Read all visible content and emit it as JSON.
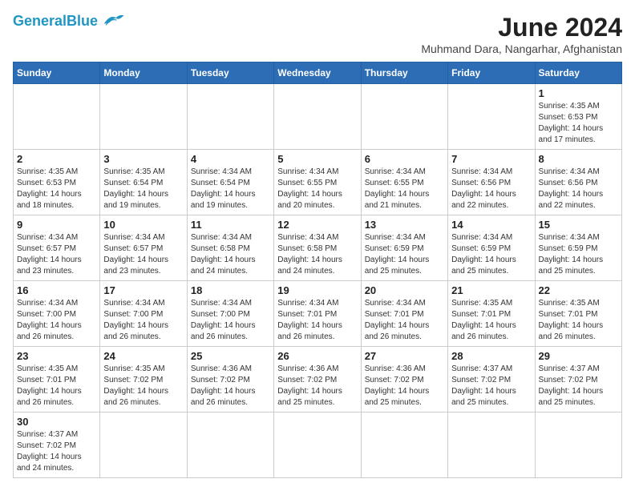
{
  "header": {
    "logo_general": "General",
    "logo_blue": "Blue",
    "title": "June 2024",
    "subtitle": "Muhmand Dara, Nangarhar, Afghanistan"
  },
  "weekdays": [
    "Sunday",
    "Monday",
    "Tuesday",
    "Wednesday",
    "Thursday",
    "Friday",
    "Saturday"
  ],
  "weeks": [
    [
      {
        "day": "",
        "info": ""
      },
      {
        "day": "",
        "info": ""
      },
      {
        "day": "",
        "info": ""
      },
      {
        "day": "",
        "info": ""
      },
      {
        "day": "",
        "info": ""
      },
      {
        "day": "",
        "info": ""
      },
      {
        "day": "1",
        "info": "Sunrise: 4:35 AM\nSunset: 6:53 PM\nDaylight: 14 hours\nand 17 minutes."
      }
    ],
    [
      {
        "day": "2",
        "info": "Sunrise: 4:35 AM\nSunset: 6:53 PM\nDaylight: 14 hours\nand 18 minutes."
      },
      {
        "day": "3",
        "info": "Sunrise: 4:35 AM\nSunset: 6:54 PM\nDaylight: 14 hours\nand 19 minutes."
      },
      {
        "day": "4",
        "info": "Sunrise: 4:34 AM\nSunset: 6:54 PM\nDaylight: 14 hours\nand 19 minutes."
      },
      {
        "day": "5",
        "info": "Sunrise: 4:34 AM\nSunset: 6:55 PM\nDaylight: 14 hours\nand 20 minutes."
      },
      {
        "day": "6",
        "info": "Sunrise: 4:34 AM\nSunset: 6:55 PM\nDaylight: 14 hours\nand 21 minutes."
      },
      {
        "day": "7",
        "info": "Sunrise: 4:34 AM\nSunset: 6:56 PM\nDaylight: 14 hours\nand 22 minutes."
      },
      {
        "day": "8",
        "info": "Sunrise: 4:34 AM\nSunset: 6:56 PM\nDaylight: 14 hours\nand 22 minutes."
      }
    ],
    [
      {
        "day": "9",
        "info": "Sunrise: 4:34 AM\nSunset: 6:57 PM\nDaylight: 14 hours\nand 23 minutes."
      },
      {
        "day": "10",
        "info": "Sunrise: 4:34 AM\nSunset: 6:57 PM\nDaylight: 14 hours\nand 23 minutes."
      },
      {
        "day": "11",
        "info": "Sunrise: 4:34 AM\nSunset: 6:58 PM\nDaylight: 14 hours\nand 24 minutes."
      },
      {
        "day": "12",
        "info": "Sunrise: 4:34 AM\nSunset: 6:58 PM\nDaylight: 14 hours\nand 24 minutes."
      },
      {
        "day": "13",
        "info": "Sunrise: 4:34 AM\nSunset: 6:59 PM\nDaylight: 14 hours\nand 25 minutes."
      },
      {
        "day": "14",
        "info": "Sunrise: 4:34 AM\nSunset: 6:59 PM\nDaylight: 14 hours\nand 25 minutes."
      },
      {
        "day": "15",
        "info": "Sunrise: 4:34 AM\nSunset: 6:59 PM\nDaylight: 14 hours\nand 25 minutes."
      }
    ],
    [
      {
        "day": "16",
        "info": "Sunrise: 4:34 AM\nSunset: 7:00 PM\nDaylight: 14 hours\nand 26 minutes."
      },
      {
        "day": "17",
        "info": "Sunrise: 4:34 AM\nSunset: 7:00 PM\nDaylight: 14 hours\nand 26 minutes."
      },
      {
        "day": "18",
        "info": "Sunrise: 4:34 AM\nSunset: 7:00 PM\nDaylight: 14 hours\nand 26 minutes."
      },
      {
        "day": "19",
        "info": "Sunrise: 4:34 AM\nSunset: 7:01 PM\nDaylight: 14 hours\nand 26 minutes."
      },
      {
        "day": "20",
        "info": "Sunrise: 4:34 AM\nSunset: 7:01 PM\nDaylight: 14 hours\nand 26 minutes."
      },
      {
        "day": "21",
        "info": "Sunrise: 4:35 AM\nSunset: 7:01 PM\nDaylight: 14 hours\nand 26 minutes."
      },
      {
        "day": "22",
        "info": "Sunrise: 4:35 AM\nSunset: 7:01 PM\nDaylight: 14 hours\nand 26 minutes."
      }
    ],
    [
      {
        "day": "23",
        "info": "Sunrise: 4:35 AM\nSunset: 7:01 PM\nDaylight: 14 hours\nand 26 minutes."
      },
      {
        "day": "24",
        "info": "Sunrise: 4:35 AM\nSunset: 7:02 PM\nDaylight: 14 hours\nand 26 minutes."
      },
      {
        "day": "25",
        "info": "Sunrise: 4:36 AM\nSunset: 7:02 PM\nDaylight: 14 hours\nand 26 minutes."
      },
      {
        "day": "26",
        "info": "Sunrise: 4:36 AM\nSunset: 7:02 PM\nDaylight: 14 hours\nand 25 minutes."
      },
      {
        "day": "27",
        "info": "Sunrise: 4:36 AM\nSunset: 7:02 PM\nDaylight: 14 hours\nand 25 minutes."
      },
      {
        "day": "28",
        "info": "Sunrise: 4:37 AM\nSunset: 7:02 PM\nDaylight: 14 hours\nand 25 minutes."
      },
      {
        "day": "29",
        "info": "Sunrise: 4:37 AM\nSunset: 7:02 PM\nDaylight: 14 hours\nand 25 minutes."
      }
    ],
    [
      {
        "day": "30",
        "info": "Sunrise: 4:37 AM\nSunset: 7:02 PM\nDaylight: 14 hours\nand 24 minutes."
      },
      {
        "day": "",
        "info": ""
      },
      {
        "day": "",
        "info": ""
      },
      {
        "day": "",
        "info": ""
      },
      {
        "day": "",
        "info": ""
      },
      {
        "day": "",
        "info": ""
      },
      {
        "day": "",
        "info": ""
      }
    ]
  ]
}
